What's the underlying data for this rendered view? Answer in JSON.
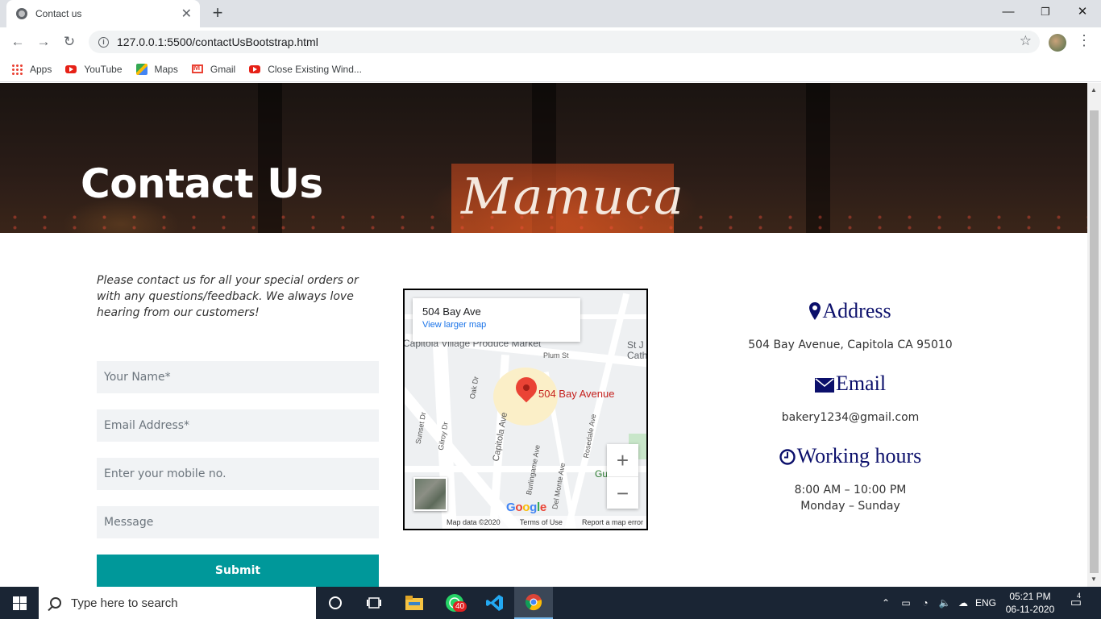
{
  "browser": {
    "tab_title": "Contact us",
    "url": "127.0.0.1:5500/contactUsBootstrap.html",
    "bookmarks": [
      "Apps",
      "YouTube",
      "Maps",
      "Gmail",
      "Close Existing Wind..."
    ]
  },
  "hero": {
    "title": "Contact Us",
    "sign_text": "Mamuca"
  },
  "form": {
    "intro": "Please contact us for all your special orders or with any questions/feedback. We always love hearing from our customers!",
    "name_placeholder": "Your Name*",
    "email_placeholder": "Email Address*",
    "mobile_placeholder": "Enter your mobile no.",
    "message_placeholder": "Message",
    "submit_label": "Submit"
  },
  "map": {
    "place_title": "504 Bay Ave",
    "view_larger": "View larger map",
    "marker_label": "504 Bay Avenue",
    "poi_market": "Capitola Village Produce Market",
    "poi_church": "St J Catholic",
    "poi_park": "Gu  ark",
    "streets": [
      "Plum St",
      "Oak Dr",
      "Sunset Dr",
      "Gilroy Dr",
      "Capitola Ave",
      "Burlingame Ave",
      "Del Monte Ave",
      "Rosedale Ave"
    ],
    "google": "Google",
    "footer": {
      "data": "Map data ©2020",
      "terms": "Terms of Use",
      "report": "Report a map error"
    }
  },
  "info": {
    "address_heading": "Address",
    "address": "504 Bay Avenue, Capitola CA 95010",
    "email_heading": "Email",
    "email": "bakery1234@gmail.com",
    "hours_heading": "Working hours",
    "hours_time": "8:00 AM – 10:00 PM",
    "hours_days": "Monday – Sunday"
  },
  "taskbar": {
    "search_placeholder": "Type here to search",
    "whatsapp_badge": "40",
    "language": "ENG",
    "time": "05:21 PM",
    "date": "06-11-2020",
    "notification_count": "4"
  },
  "colors": {
    "heading_navy": "#0b0f6b",
    "submit_teal": "#00989a",
    "taskbar_bg": "#1a2534"
  }
}
